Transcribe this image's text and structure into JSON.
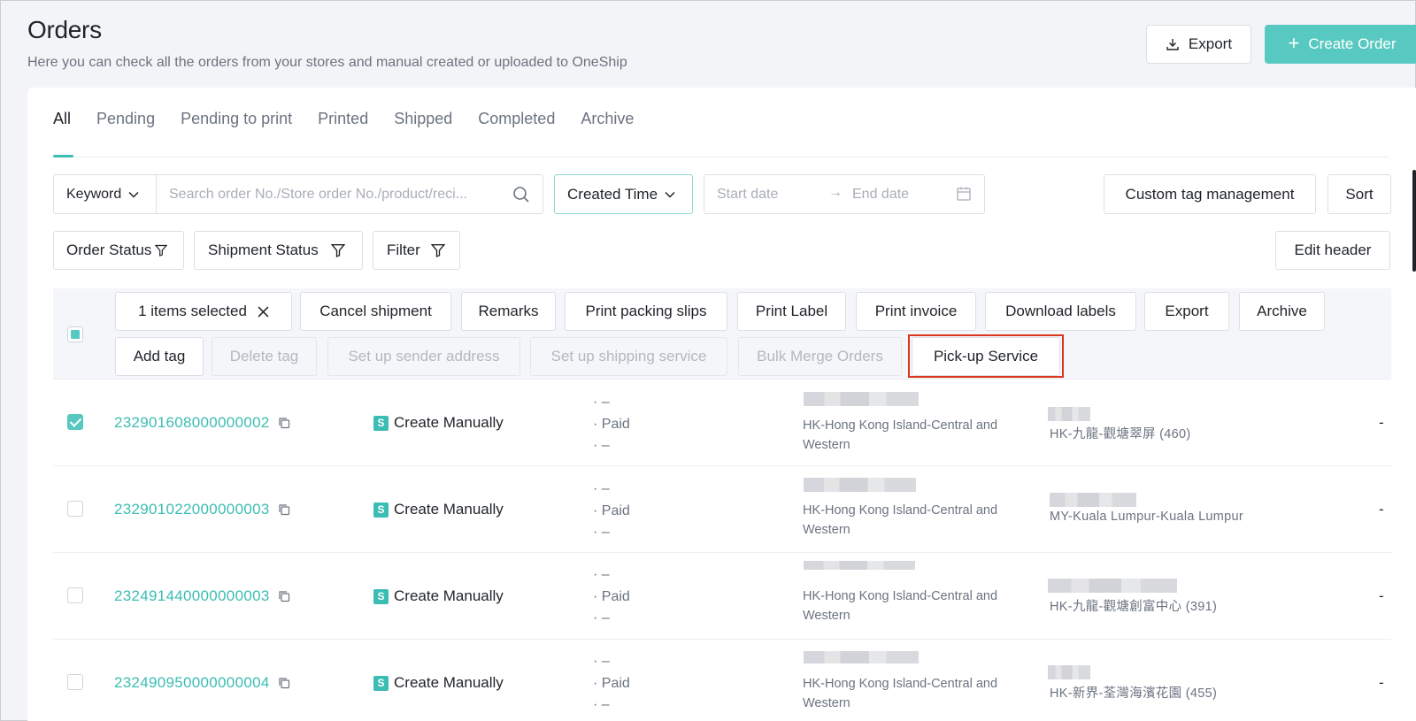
{
  "header": {
    "title": "Orders",
    "subtitle": "Here you can check all the orders from your stores and manual created or uploaded to OneShip",
    "export_label": "Export",
    "create_label": "Create Order"
  },
  "tabs": [
    "All",
    "Pending",
    "Pending to print",
    "Printed",
    "Shipped",
    "Completed",
    "Archive"
  ],
  "search": {
    "keyword_label": "Keyword",
    "placeholder": "Search order No./Store order No./product/reci...",
    "created_time_label": "Created Time",
    "start_placeholder": "Start date",
    "end_placeholder": "End date",
    "custom_tag_label": "Custom tag management",
    "sort_label": "Sort"
  },
  "filters": {
    "order_status": "Order Status",
    "shipment_status": "Shipment Status",
    "filter": "Filter",
    "edit_header": "Edit header"
  },
  "bulk": {
    "selected_label": "1 items selected",
    "actions_row1": [
      "Cancel shipment",
      "Remarks",
      "Print packing slips",
      "Print Label",
      "Print invoice",
      "Download labels",
      "Export",
      "Archive"
    ],
    "actions_row2": [
      "Add tag",
      "Delete tag",
      "Set up sender address",
      "Set up shipping service",
      "Bulk Merge Orders",
      "Pick-up Service"
    ]
  },
  "orders": [
    {
      "order_no": "232901608000000002",
      "source": "Create Manually",
      "status_top": "–",
      "status_mid": "Paid",
      "status_bot": "–",
      "origin": "HK-Hong Kong Island-Central and Western",
      "destination": "HK-九龍-觀塘翠屏 (460)",
      "extra": "-",
      "checked": true
    },
    {
      "order_no": "232901022000000003",
      "source": "Create Manually",
      "status_top": "–",
      "status_mid": "Paid",
      "status_bot": "–",
      "origin": "HK-Hong Kong Island-Central and Western",
      "destination": "MY-Kuala Lumpur-Kuala Lumpur",
      "extra": "-",
      "checked": false
    },
    {
      "order_no": "232491440000000003",
      "source": "Create Manually",
      "status_top": "–",
      "status_mid": "Paid",
      "status_bot": "–",
      "origin": "HK-Hong Kong Island-Central and Western",
      "destination": "HK-九龍-觀塘創富中心 (391)",
      "extra": "-",
      "checked": false
    },
    {
      "order_no": "232490950000000004",
      "source": "Create Manually",
      "status_top": "–",
      "status_mid": "Paid",
      "status_bot": "–",
      "origin": "HK-Hong Kong Island-Central and Western",
      "destination": "HK-新界-荃灣海濱花園 (455)",
      "extra": "-",
      "checked": false
    }
  ],
  "colors": {
    "accent": "#58c9c0",
    "link": "#3cbdb3",
    "highlight": "#d9361e"
  }
}
